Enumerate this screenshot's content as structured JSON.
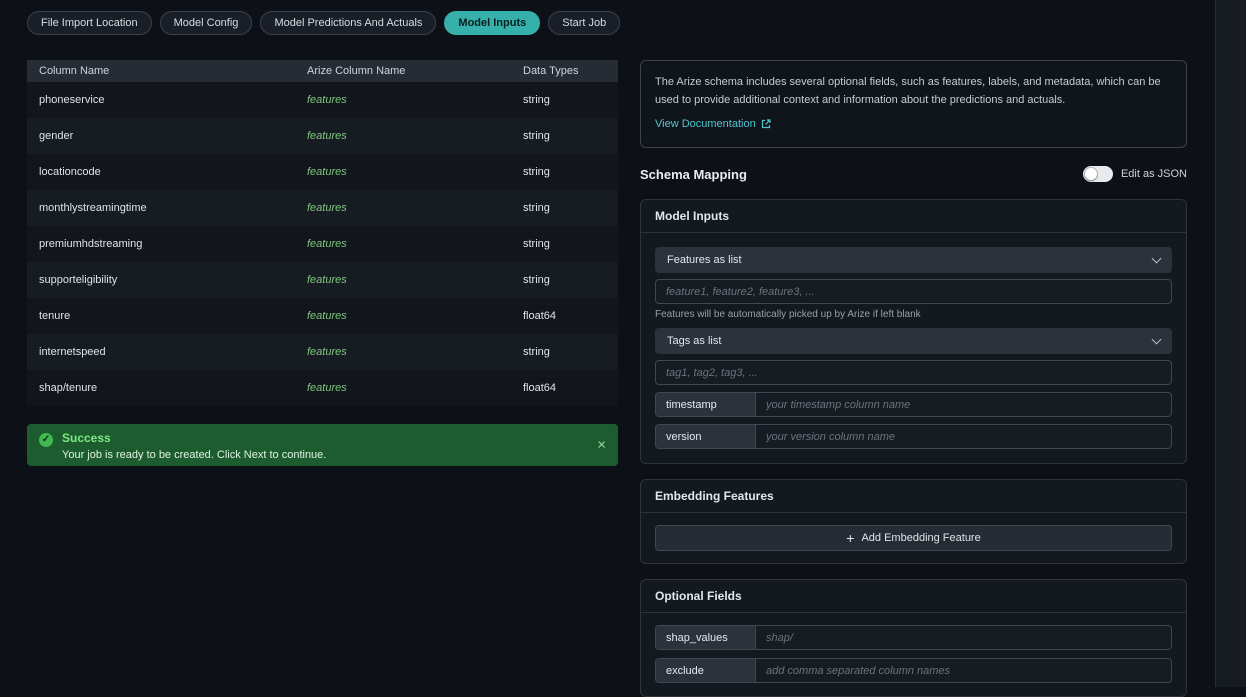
{
  "tabs": [
    {
      "label": "File Import Location",
      "active": false
    },
    {
      "label": "Model Config",
      "active": false
    },
    {
      "label": "Model Predictions And Actuals",
      "active": false
    },
    {
      "label": "Model Inputs",
      "active": true
    },
    {
      "label": "Start Job",
      "active": false
    }
  ],
  "table": {
    "headers": [
      "Column Name",
      "Arize Column Name",
      "Data Types"
    ],
    "rows": [
      {
        "column_name": "phoneservice",
        "arize_column_name": "features",
        "data_type": "string"
      },
      {
        "column_name": "gender",
        "arize_column_name": "features",
        "data_type": "string"
      },
      {
        "column_name": "locationcode",
        "arize_column_name": "features",
        "data_type": "string"
      },
      {
        "column_name": "monthlystreamingtime",
        "arize_column_name": "features",
        "data_type": "string"
      },
      {
        "column_name": "premiumhdstreaming",
        "arize_column_name": "features",
        "data_type": "string"
      },
      {
        "column_name": "supporteligibility",
        "arize_column_name": "features",
        "data_type": "string"
      },
      {
        "column_name": "tenure",
        "arize_column_name": "features",
        "data_type": "float64"
      },
      {
        "column_name": "internetspeed",
        "arize_column_name": "features",
        "data_type": "string"
      },
      {
        "column_name": "shap/tenure",
        "arize_column_name": "features",
        "data_type": "float64"
      }
    ]
  },
  "success_banner": {
    "title": "Success",
    "message": "Your job is ready to be created. Click Next to continue."
  },
  "info_box": {
    "text": "The Arize schema includes several optional fields, such as features, labels, and metadata, which can be used to provide additional context and information about the predictions and actuals.",
    "link_label": "View Documentation"
  },
  "schema_mapping": {
    "title": "Schema Mapping",
    "toggle_label": "Edit as JSON"
  },
  "model_inputs": {
    "title": "Model Inputs",
    "features_select": "Features as list",
    "features_placeholder": "feature1, feature2, feature3, ...",
    "features_helper": "Features will be automatically picked up by Arize if left blank",
    "tags_select": "Tags as list",
    "tags_placeholder": "tag1, tag2, tag3, ...",
    "timestamp_label": "timestamp",
    "timestamp_placeholder": "your timestamp column name",
    "version_label": "version",
    "version_placeholder": "your version column name"
  },
  "embedding_features": {
    "title": "Embedding Features",
    "add_button_label": "Add Embedding Feature"
  },
  "optional_fields": {
    "title": "Optional Fields",
    "shap_label": "shap_values",
    "shap_placeholder": "shap/",
    "exclude_label": "exclude",
    "exclude_placeholder": "add comma separated column names"
  },
  "icons": {
    "check": "✓",
    "close": "×",
    "plus": "+"
  },
  "colors": {
    "background": "#0d1117",
    "accent_teal": "#35b0ab",
    "link_teal": "#53c4cf",
    "features_green": "#7cc77c",
    "success_bg": "#1d5c2e",
    "success_text": "#7ee787"
  }
}
